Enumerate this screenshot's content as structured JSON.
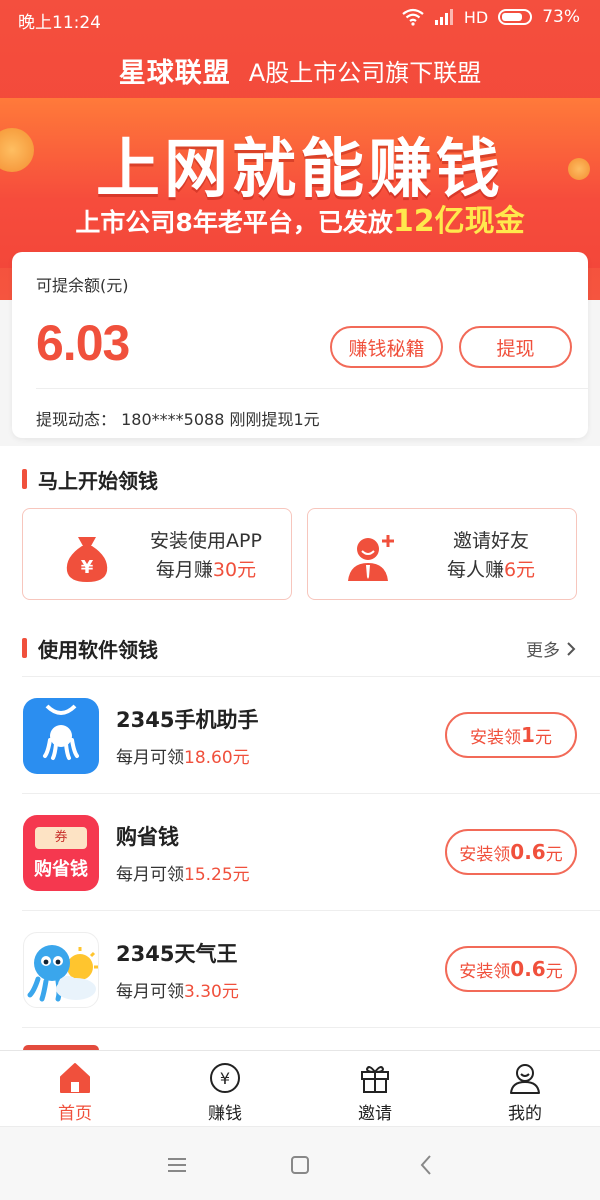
{
  "status_bar": {
    "time": "晚上11:24",
    "network": "HD",
    "battery": "73%"
  },
  "header": {
    "logo": "星球联盟",
    "slogan": "A股上市公司旗下联盟"
  },
  "banner": {
    "title": "上网就能赚钱",
    "subtitle_prefix": "上市公司8年老平台，已发放",
    "subtitle_highlight": "12亿现金"
  },
  "balance": {
    "label": "可提余额(元)",
    "value": "6.03",
    "tips_button": "赚钱秘籍",
    "withdraw_button": "提现",
    "feed_label": "提现动态：",
    "feed_text": "180****5088 刚刚提现1元"
  },
  "start_section": {
    "title": "马上开始领钱",
    "cards": [
      {
        "icon": "money-bag-icon",
        "line1": "安装使用APP",
        "line2_prefix": "每月赚",
        "line2_amount": "30元"
      },
      {
        "icon": "invite-friend-icon",
        "line1": "邀请好友",
        "line2_prefix": "每人赚",
        "line2_amount": "6元"
      }
    ]
  },
  "apps_section": {
    "title": "使用软件领钱",
    "more": "更多",
    "apps": [
      {
        "name": "2345手机助手",
        "earn_prefix": "每月可领",
        "earn_amount": "18.60元",
        "btn_prefix": "安装领",
        "btn_amount": "1",
        "btn_suffix": "元",
        "icon": "phone-assistant-icon"
      },
      {
        "name": "购省钱",
        "earn_prefix": "每月可领",
        "earn_amount": "15.25元",
        "btn_prefix": "安装领",
        "btn_amount": "0.6",
        "btn_suffix": "元",
        "icon": "gou-sheng-qian-icon",
        "icon_text": "购省钱",
        "icon_ticket": "券"
      },
      {
        "name": "2345天气王",
        "earn_prefix": "每月可领",
        "earn_amount": "3.30元",
        "btn_prefix": "安装领",
        "btn_amount": "0.6",
        "btn_suffix": "元",
        "icon": "weather-king-icon"
      }
    ]
  },
  "tabs": [
    {
      "label": "首页",
      "icon": "home-icon",
      "active": true
    },
    {
      "label": "赚钱",
      "icon": "yuan-coin-icon",
      "active": false
    },
    {
      "label": "邀请",
      "icon": "gift-icon",
      "active": false
    },
    {
      "label": "我的",
      "icon": "profile-icon",
      "active": false
    }
  ],
  "colors": {
    "brand_red": "#f0503c",
    "banner_gold": "#ffe84d",
    "phone_assistant_blue": "#2b8ef0",
    "gou_sheng_qian_pink": "#f5384f"
  }
}
